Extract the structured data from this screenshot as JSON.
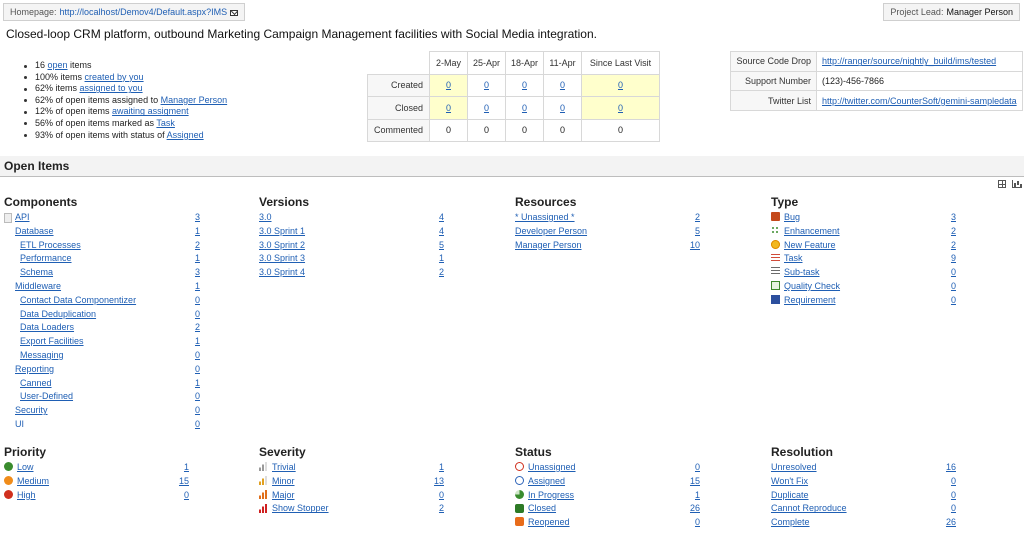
{
  "header": {
    "homepage_label": "Homepage:",
    "homepage_url": "http://localhost/Demov4/Default.aspx?IMS",
    "project_lead_label": "Project Lead:",
    "project_lead_value": "Manager Person"
  },
  "description": "Closed-loop CRM platform, outbound Marketing Campaign Management facilities with Social Media integration.",
  "stats": [
    {
      "pre": "16 ",
      "link": "open",
      "post": " items"
    },
    {
      "pre": "100% items ",
      "link": "created by you",
      "post": ""
    },
    {
      "pre": "62% items ",
      "link": "assigned to you",
      "post": ""
    },
    {
      "pre": "62% of open items assigned to ",
      "link": "Manager Person",
      "post": ""
    },
    {
      "pre": "12% of open items ",
      "link": "awaiting assigment",
      "post": ""
    },
    {
      "pre": "56% of open items marked as ",
      "link": "Task",
      "post": ""
    },
    {
      "pre": "93% of open items with status of ",
      "link": "Assigned",
      "post": ""
    }
  ],
  "activity": {
    "columns": [
      "2-May",
      "25-Apr",
      "18-Apr",
      "11-Apr",
      "Since Last Visit"
    ],
    "rows": [
      {
        "label": "Created",
        "values": [
          "0",
          "0",
          "0",
          "0",
          "0"
        ],
        "links": true
      },
      {
        "label": "Closed",
        "values": [
          "0",
          "0",
          "0",
          "0",
          "0"
        ],
        "links": true
      },
      {
        "label": "Commented",
        "values": [
          "0",
          "0",
          "0",
          "0",
          "0"
        ],
        "links": false
      }
    ]
  },
  "info": [
    {
      "key": "Source Code Drop",
      "value": "http://ranger/source/nightly_build/ims/tested",
      "link": true
    },
    {
      "key": "Support Number",
      "value": "(123)-456-7866",
      "link": false
    },
    {
      "key": "Twitter List",
      "value": "http://twitter.com/CounterSoft/gemini-sampledata",
      "link": true
    }
  ],
  "open_items_title": "Open Items",
  "components": {
    "title": "Components",
    "items": [
      {
        "label": "API",
        "count": "3",
        "indent": 0,
        "link": true
      },
      {
        "label": "Database",
        "count": "1",
        "indent": 0,
        "link": true
      },
      {
        "label": "ETL Processes",
        "count": "2",
        "indent": 1,
        "link": true
      },
      {
        "label": "Performance",
        "count": "1",
        "indent": 1,
        "link": true
      },
      {
        "label": "Schema",
        "count": "3",
        "indent": 1,
        "link": true
      },
      {
        "label": "Middleware",
        "count": "1",
        "indent": 0,
        "link": true
      },
      {
        "label": "Contact Data Componentizer",
        "count": "0",
        "indent": 1,
        "link": true
      },
      {
        "label": "Data Deduplication",
        "count": "0",
        "indent": 1,
        "link": true
      },
      {
        "label": "Data Loaders",
        "count": "2",
        "indent": 1,
        "link": true
      },
      {
        "label": "Export Facilities",
        "count": "1",
        "indent": 1,
        "link": true
      },
      {
        "label": "Messaging",
        "count": "0",
        "indent": 1,
        "link": true
      },
      {
        "label": "Reporting",
        "count": "0",
        "indent": 0,
        "link": true
      },
      {
        "label": "Canned",
        "count": "1",
        "indent": 1,
        "link": true
      },
      {
        "label": "User-Defined",
        "count": "0",
        "indent": 1,
        "link": true
      },
      {
        "label": "Security",
        "count": "0",
        "indent": 0,
        "link": true
      },
      {
        "label": "UI",
        "count": "0",
        "indent": 0,
        "link": false
      }
    ]
  },
  "versions": {
    "title": "Versions",
    "items": [
      {
        "label": "3.0",
        "count": "4"
      },
      {
        "label": "3.0 Sprint 1",
        "count": "4"
      },
      {
        "label": "3.0 Sprint 2",
        "count": "5"
      },
      {
        "label": "3.0 Sprint 3",
        "count": "1"
      },
      {
        "label": "3.0 Sprint 4",
        "count": "2"
      }
    ]
  },
  "resources": {
    "title": "Resources",
    "items": [
      {
        "label": "* Unassigned *",
        "count": "2"
      },
      {
        "label": "Developer Person",
        "count": "5"
      },
      {
        "label": "Manager Person",
        "count": "10"
      }
    ]
  },
  "type": {
    "title": "Type",
    "items": [
      {
        "label": "Bug",
        "count": "3",
        "icon": "bug-icon"
      },
      {
        "label": "Enhancement",
        "count": "2",
        "icon": "enhancement-icon"
      },
      {
        "label": "New Feature",
        "count": "2",
        "icon": "new-feature-icon"
      },
      {
        "label": "Task",
        "count": "9",
        "icon": "task-icon"
      },
      {
        "label": "Sub-task",
        "count": "0",
        "icon": "sub-task-icon"
      },
      {
        "label": "Quality Check",
        "count": "0",
        "icon": "quality-check-icon"
      },
      {
        "label": "Requirement",
        "count": "0",
        "icon": "requirement-icon"
      }
    ]
  },
  "priority": {
    "title": "Priority",
    "items": [
      {
        "label": "Low",
        "count": "1",
        "icon": "priority-low-icon"
      },
      {
        "label": "Medium",
        "count": "15",
        "icon": "priority-medium-icon"
      },
      {
        "label": "High",
        "count": "0",
        "icon": "priority-high-icon"
      }
    ]
  },
  "severity": {
    "title": "Severity",
    "items": [
      {
        "label": "Trivial",
        "count": "1",
        "icon": "severity-trivial-icon"
      },
      {
        "label": "Minor",
        "count": "13",
        "icon": "severity-minor-icon"
      },
      {
        "label": "Major",
        "count": "0",
        "icon": "severity-major-icon"
      },
      {
        "label": "Show Stopper",
        "count": "2",
        "icon": "severity-show-stopper-icon"
      }
    ]
  },
  "status": {
    "title": "Status",
    "items": [
      {
        "label": "Unassigned",
        "count": "0",
        "icon": "status-unassigned-icon"
      },
      {
        "label": "Assigned",
        "count": "15",
        "icon": "status-assigned-icon"
      },
      {
        "label": "In Progress",
        "count": "1",
        "icon": "status-in-progress-icon"
      },
      {
        "label": "Closed",
        "count": "26",
        "icon": "status-closed-icon"
      },
      {
        "label": "Reopened",
        "count": "0",
        "icon": "status-reopened-icon"
      }
    ]
  },
  "resolution": {
    "title": "Resolution",
    "items": [
      {
        "label": "Unresolved",
        "count": "16"
      },
      {
        "label": "Won't Fix",
        "count": "0"
      },
      {
        "label": "Duplicate",
        "count": "0"
      },
      {
        "label": "Cannot Reproduce",
        "count": "0"
      },
      {
        "label": "Complete",
        "count": "26"
      }
    ]
  }
}
